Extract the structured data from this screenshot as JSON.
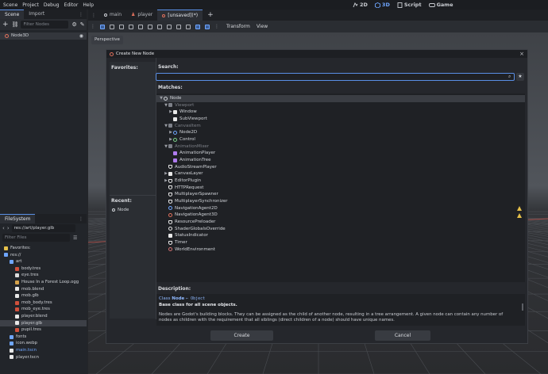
{
  "menubar": {
    "items": [
      "Scene",
      "Project",
      "Debug",
      "Editor",
      "Help"
    ]
  },
  "main_modes": {
    "items": [
      "2D",
      "3D",
      "Script",
      "Game"
    ],
    "active": "3D"
  },
  "scene_dock": {
    "tabs": [
      "Scene",
      "Import"
    ],
    "filter_placeholder": "Filter Nodes",
    "root_node": "Node3D"
  },
  "filesystem_dock": {
    "title": "FileSystem",
    "path": "res://art/player.glb",
    "filter_placeholder": "Filter Files",
    "items": [
      {
        "label": "Favorites:",
        "depth": 0,
        "color": "#e5c04a"
      },
      {
        "label": "res://",
        "depth": 0,
        "color": "#6fa6ff"
      },
      {
        "label": "art",
        "depth": 1,
        "color": "#6fa6ff"
      },
      {
        "label": "body.tres",
        "depth": 2,
        "color": "#d0503c"
      },
      {
        "label": "eye.tres",
        "depth": 2,
        "color": "#dddddd"
      },
      {
        "label": "House In a Forest Loop.ogg",
        "depth": 2,
        "color": "#d5a24a"
      },
      {
        "label": "mob.blend",
        "depth": 2,
        "color": "#e8e8e8"
      },
      {
        "label": "mob.glb",
        "depth": 2,
        "color": "#e8e8e8"
      },
      {
        "label": "mob_body.tres",
        "depth": 2,
        "color": "#d0503c"
      },
      {
        "label": "mob_eye.tres",
        "depth": 2,
        "color": "#d0503c"
      },
      {
        "label": "player.blend",
        "depth": 2,
        "color": "#e8e8e8"
      },
      {
        "label": "player.glb",
        "depth": 2,
        "color": "#e8e8e8",
        "selected": true
      },
      {
        "label": "pupil.tres",
        "depth": 2,
        "color": "#d0503c"
      },
      {
        "label": "fonts",
        "depth": 1,
        "color": "#6fa6ff"
      },
      {
        "label": "icon.webp",
        "depth": 1,
        "color": "#6fa6ff"
      },
      {
        "label": "main.tscn",
        "depth": 1,
        "color": "#e8e8e8",
        "textColor": "#6fa6ff"
      },
      {
        "label": "player.tscn",
        "depth": 1,
        "color": "#e8e8e8"
      }
    ]
  },
  "editor_tabs": {
    "tabs": [
      {
        "label": "main",
        "active": false
      },
      {
        "label": "player",
        "active": false
      },
      {
        "label": "[unsaved](*)",
        "active": true
      }
    ]
  },
  "toolbar3d": {
    "transform_label": "Transform",
    "view_label": "View"
  },
  "viewport": {
    "perspective_label": "Perspective"
  },
  "dialog": {
    "title": "Create New Node",
    "favorites_label": "Favorites:",
    "recent_label": "Recent:",
    "recent_items": [
      "Node"
    ],
    "search_label": "Search:",
    "search_value": "",
    "matches_label": "Matches:",
    "matches": [
      {
        "label": "Node",
        "depth": 0,
        "arrow": "▼",
        "icon": "circle",
        "color": "#cfd2d7",
        "selected": true
      },
      {
        "label": "Viewport",
        "depth": 1,
        "arrow": "▼",
        "icon": "square",
        "color": "#7d8088",
        "disabled": true
      },
      {
        "label": "Window",
        "depth": 2,
        "arrow": "▶",
        "icon": "window",
        "color": "#e8e8e8"
      },
      {
        "label": "SubViewport",
        "depth": 2,
        "arrow": "",
        "icon": "square",
        "color": "#e8e8e8"
      },
      {
        "label": "CanvasItem",
        "depth": 1,
        "arrow": "▼",
        "icon": "pencil",
        "color": "#7d8088",
        "disabled": true
      },
      {
        "label": "Node2D",
        "depth": 2,
        "arrow": "▶",
        "icon": "circle",
        "color": "#6fa6ff"
      },
      {
        "label": "Control",
        "depth": 2,
        "arrow": "▶",
        "icon": "circle",
        "color": "#7dd38a"
      },
      {
        "label": "AnimationMixer",
        "depth": 1,
        "arrow": "▼",
        "icon": "square",
        "color": "#7d8088",
        "disabled": true
      },
      {
        "label": "AnimationPlayer",
        "depth": 2,
        "arrow": "",
        "icon": "square",
        "color": "#b07cf0"
      },
      {
        "label": "AnimationTree",
        "depth": 2,
        "arrow": "",
        "icon": "square",
        "color": "#b07cf0"
      },
      {
        "label": "AudioStreamPlayer",
        "depth": 1,
        "arrow": "",
        "icon": "speaker",
        "color": "#e8e8e8"
      },
      {
        "label": "CanvasLayer",
        "depth": 1,
        "arrow": "▶",
        "icon": "square",
        "color": "#e8e8e8"
      },
      {
        "label": "EditorPlugin",
        "depth": 1,
        "arrow": "▶",
        "icon": "plug",
        "color": "#e8e8e8"
      },
      {
        "label": "HTTPRequest",
        "depth": 1,
        "arrow": "",
        "icon": "arrows",
        "color": "#e8e8e8"
      },
      {
        "label": "MultiplayerSpawner",
        "depth": 1,
        "arrow": "",
        "icon": "wifi",
        "color": "#e8e8e8"
      },
      {
        "label": "MultiplayerSynchronizer",
        "depth": 1,
        "arrow": "",
        "icon": "wifi",
        "color": "#e8e8e8"
      },
      {
        "label": "NavigationAgent2D",
        "depth": 1,
        "arrow": "",
        "icon": "circle",
        "color": "#6fa6ff",
        "warning": true
      },
      {
        "label": "NavigationAgent3D",
        "depth": 1,
        "arrow": "",
        "icon": "circle",
        "color": "#e0705c",
        "warning": true
      },
      {
        "label": "ResourcePreloader",
        "depth": 1,
        "arrow": "",
        "icon": "eye",
        "color": "#e8e8e8"
      },
      {
        "label": "ShaderGlobalsOverride",
        "depth": 1,
        "arrow": "",
        "icon": "circle",
        "color": "#e8e8e8"
      },
      {
        "label": "StatusIndicator",
        "depth": 1,
        "arrow": "",
        "icon": "square",
        "color": "#e8e8e8"
      },
      {
        "label": "Timer",
        "depth": 1,
        "arrow": "",
        "icon": "hourglass",
        "color": "#e8e8e8"
      },
      {
        "label": "WorldEnvironment",
        "depth": 1,
        "arrow": "",
        "icon": "globe",
        "color": "#d07070"
      }
    ],
    "description_label": "Description:",
    "class_prefix": "Class",
    "class_name": "Node",
    "inherits": "⇐ Object",
    "brief": "Base class for all scene objects.",
    "body": "Nodes are Godot's building blocks. They can be assigned as the child of another node, resulting in a tree arrangement. A given node can contain any number of nodes as children with the requirement that all siblings (direct children of a node) should have unique names.",
    "create_label": "Create",
    "cancel_label": "Cancel",
    "close_glyph": "×",
    "favorite_glyph": "★"
  }
}
